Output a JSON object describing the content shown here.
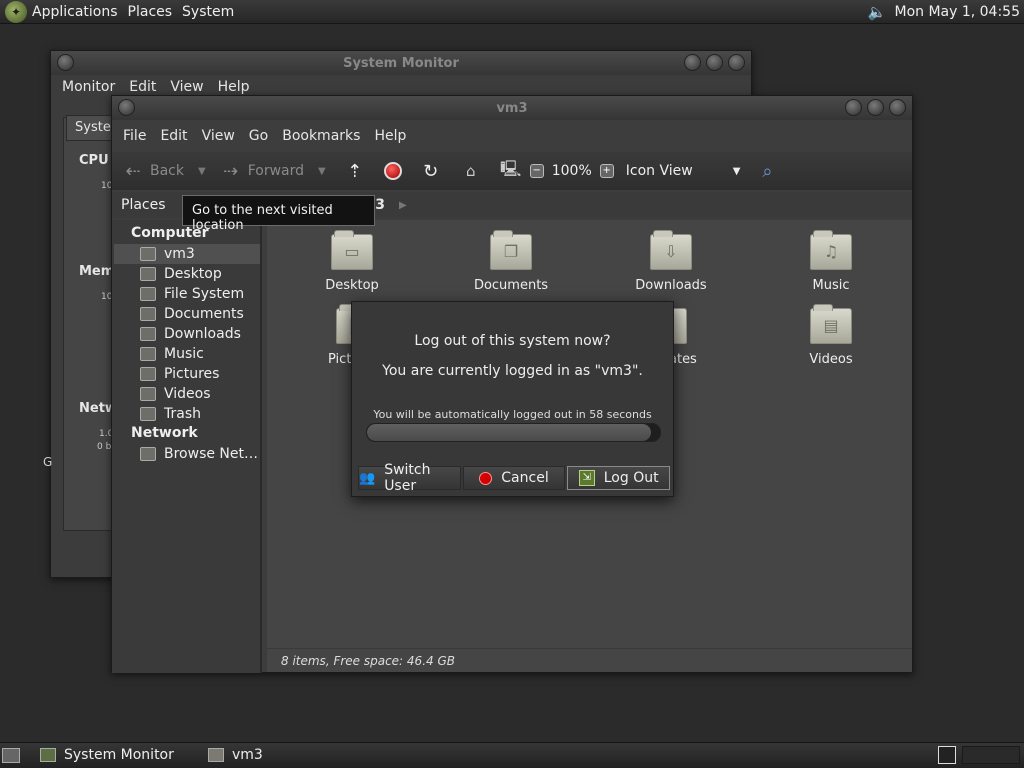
{
  "top_panel": {
    "menus": [
      "Applications",
      "Places",
      "System"
    ],
    "clock": "Mon May  1, 04:55"
  },
  "system_monitor": {
    "title": "System Monitor",
    "menus": [
      "Monitor",
      "Edit",
      "View",
      "Help"
    ],
    "tab_label": "Syster",
    "cpu_label": "CPU",
    "cpu_axis": "10",
    "memory_label": "Memo",
    "memory_axis": "10",
    "network_label": "Netw",
    "network_axis_1": "1.0",
    "network_axis_2": "0 by",
    "stray_g": "G"
  },
  "file_manager": {
    "title": "vm3",
    "menus": [
      "File",
      "Edit",
      "View",
      "Go",
      "Bookmarks",
      "Help"
    ],
    "toolbar": {
      "back_label": "Back",
      "forward_label": "Forward",
      "zoom_level": "100%",
      "view_mode": "Icon View"
    },
    "places_label": "Places",
    "path_label": "vm3",
    "sidebar": {
      "computer_heading": "Computer",
      "network_heading": "Network",
      "items": [
        "vm3",
        "Desktop",
        "File System",
        "Documents",
        "Downloads",
        "Music",
        "Pictures",
        "Videos",
        "Trash"
      ],
      "network_items": [
        "Browse Net…"
      ]
    },
    "files": [
      {
        "name": "Desktop",
        "icon": "desktop-folder-icon"
      },
      {
        "name": "Documents",
        "icon": "documents-folder-icon"
      },
      {
        "name": "Downloads",
        "icon": "downloads-folder-icon"
      },
      {
        "name": "Music",
        "icon": "music-folder-icon"
      },
      {
        "name": "Pictures",
        "icon": "pictures-folder-icon"
      },
      {
        "name": "Templates",
        "icon": "templates-folder-icon"
      },
      {
        "name": "Videos",
        "icon": "videos-folder-icon"
      }
    ],
    "partial_labels": {
      "pictures": "Pict",
      "templates": "ates"
    },
    "status": "8 items, Free space: 46.4 GB"
  },
  "tooltip": "Go to the next visited location",
  "logout_dialog": {
    "title": "Log out of this system now?",
    "subtitle": "You are currently logged in as \"vm3\".",
    "countdown": "You will be automatically logged out in 58 seconds",
    "progress_fraction": 0.97,
    "buttons": {
      "switch_user": "Switch User",
      "cancel": "Cancel",
      "logout": "Log Out"
    }
  },
  "taskbar": {
    "tasks": [
      "System Monitor",
      "vm3"
    ]
  }
}
